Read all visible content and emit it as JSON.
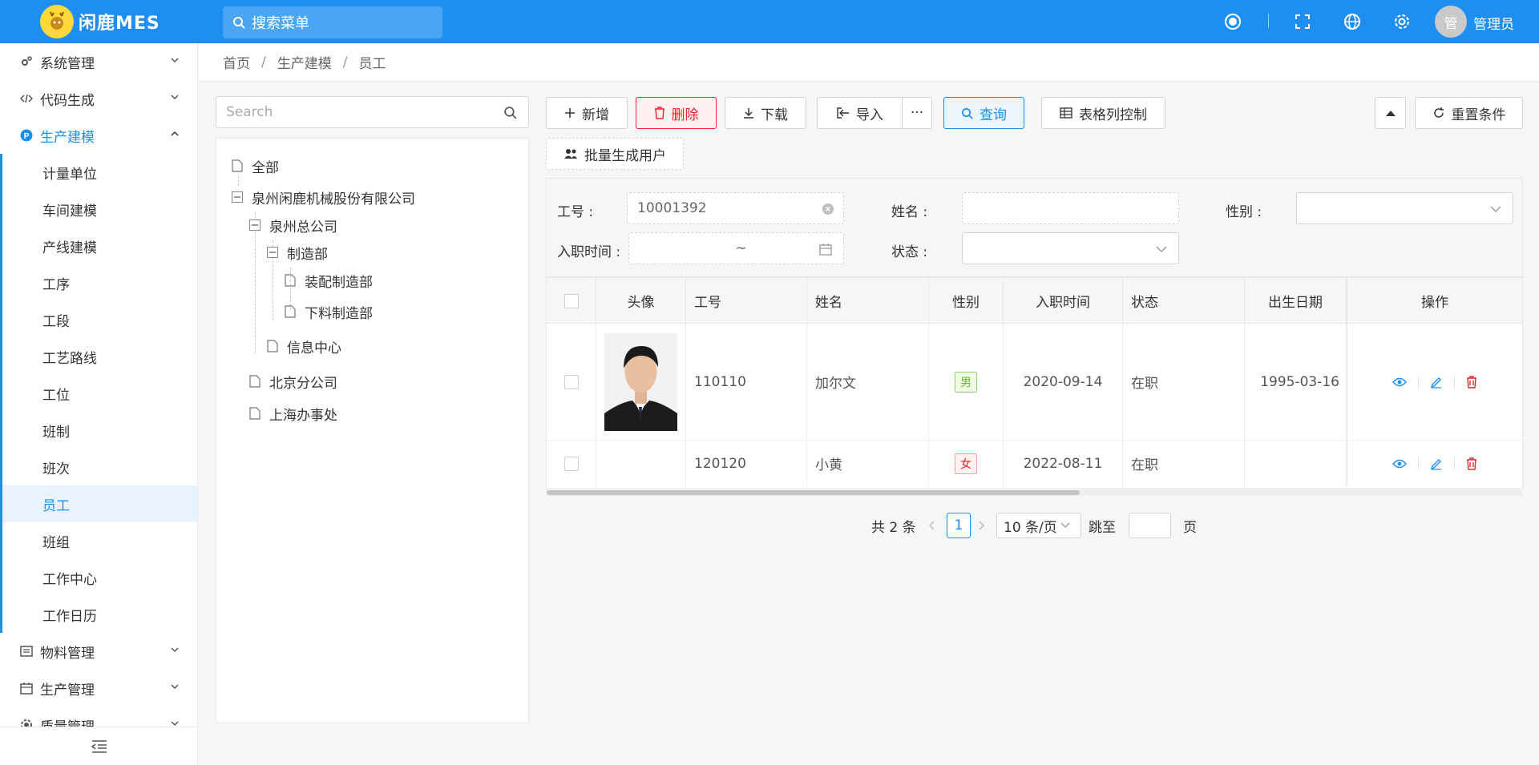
{
  "app": {
    "logo_text": "闲鹿MES",
    "user_name": "管理员",
    "avatar_text": "管"
  },
  "top_search": {
    "placeholder": "搜索菜单"
  },
  "sidebar": {
    "groups": [
      {
        "label": "系统管理",
        "icon": "gears-icon"
      },
      {
        "label": "代码生成",
        "icon": "code-icon"
      },
      {
        "label": "生产建模",
        "icon": "p-circle-icon"
      },
      {
        "label": "物料管理",
        "icon": "list-icon"
      },
      {
        "label": "生产管理",
        "icon": "calendar-icon"
      },
      {
        "label": "质量管理",
        "icon": "gear-icon"
      }
    ],
    "sub_items": [
      "计量单位",
      "车间建模",
      "产线建模",
      "工序",
      "工段",
      "工艺路线",
      "工位",
      "班制",
      "班次",
      "员工",
      "班组",
      "工作中心",
      "工作日历"
    ],
    "selected": "员工"
  },
  "breadcrumb": [
    "首页",
    "生产建模",
    "员工"
  ],
  "tree": {
    "search_placeholder": "Search",
    "nodes": [
      "全部",
      "泉州闲鹿机械股份有限公司",
      "泉州总公司",
      "制造部",
      "装配制造部",
      "下料制造部",
      "信息中心",
      "北京分公司",
      "上海办事处"
    ]
  },
  "toolbar": {
    "add": "新增",
    "delete": "删除",
    "download": "下载",
    "import": "导入",
    "more": "···",
    "query": "查询",
    "columns": "表格列控制",
    "reset": "重置条件",
    "batch_users": "批量生成用户"
  },
  "filters": {
    "emp_no_label": "工号 :",
    "emp_no_value": "10001392",
    "name_label": "姓名 :",
    "gender_label": "性别 :",
    "hire_label": "入职时间 :",
    "hire_sep": "~",
    "status_label": "状态 :"
  },
  "table": {
    "headers": [
      "头像",
      "工号",
      "姓名",
      "性别",
      "入职时间",
      "状态",
      "出生日期",
      "操作"
    ],
    "rows": [
      {
        "emp_no": "110110",
        "name": "加尔文",
        "gender": "男",
        "hire_date": "2020-09-14",
        "status": "在职",
        "birth": "1995-03-16"
      },
      {
        "emp_no": "120120",
        "name": "小黄",
        "gender": "女",
        "hire_date": "2022-08-11",
        "status": "在职",
        "birth": ""
      }
    ]
  },
  "pagination": {
    "total": "共 2 条",
    "current": "1",
    "page_size": "10 条/页",
    "jump_label": "跳至",
    "page_suffix": "页"
  },
  "colors": {
    "primary": "#1e8ff0",
    "danger": "#f5222d",
    "success": "#52c41a"
  }
}
